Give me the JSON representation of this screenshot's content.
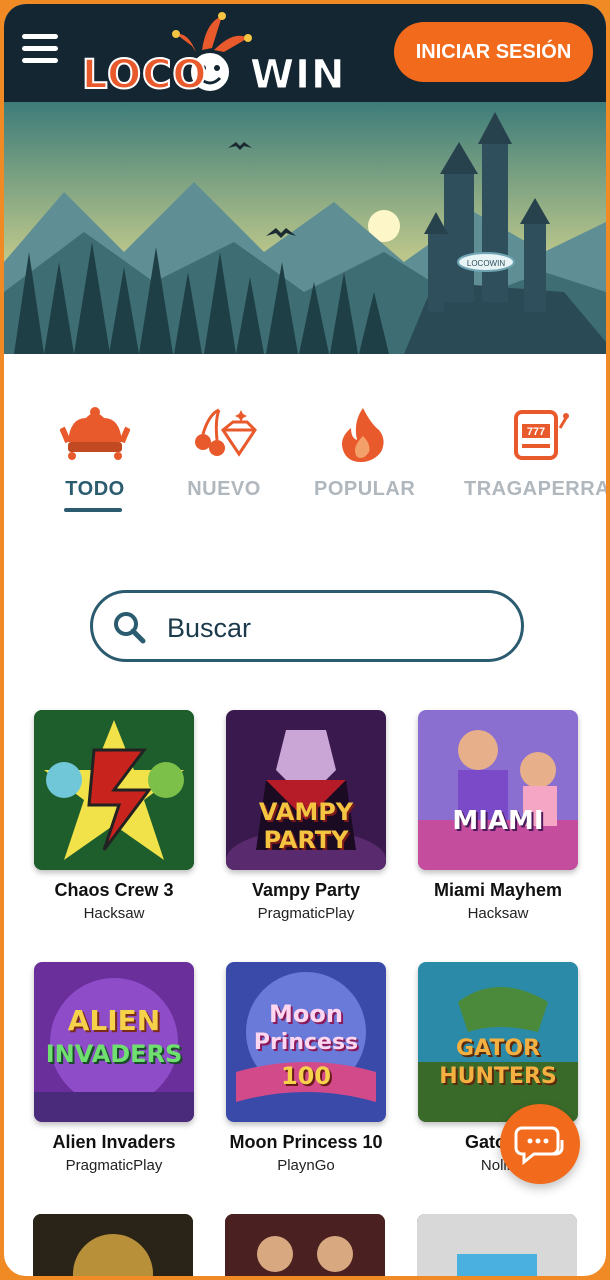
{
  "header": {
    "logo_left": "LOCO",
    "logo_right": "WIN",
    "login_label": "INICIAR SESIÓN"
  },
  "categories": [
    {
      "label": "TODO",
      "icon": "jester-hat-icon",
      "active": true
    },
    {
      "label": "NUEVO",
      "icon": "cherries-diamond-icon",
      "active": false
    },
    {
      "label": "POPULAR",
      "icon": "flame-icon",
      "active": false
    },
    {
      "label": "TRAGAPERRAS",
      "icon": "slot-machine-icon",
      "active": false
    }
  ],
  "search": {
    "placeholder": "Buscar"
  },
  "games": [
    {
      "title": "Chaos Crew 3",
      "provider": "Hacksaw"
    },
    {
      "title": "Vampy Party",
      "provider": "PragmaticPlay"
    },
    {
      "title": "Miami Mayhem",
      "provider": "Hacksaw"
    },
    {
      "title": "Alien Invaders",
      "provider": "PragmaticPlay"
    },
    {
      "title": "Moon Princess 10",
      "provider": "PlaynGo"
    },
    {
      "title": "Gator H",
      "provider": "Nolin"
    }
  ],
  "colors": {
    "accent": "#f26a1b",
    "navy": "#142632",
    "teal": "#2b5b6f"
  }
}
